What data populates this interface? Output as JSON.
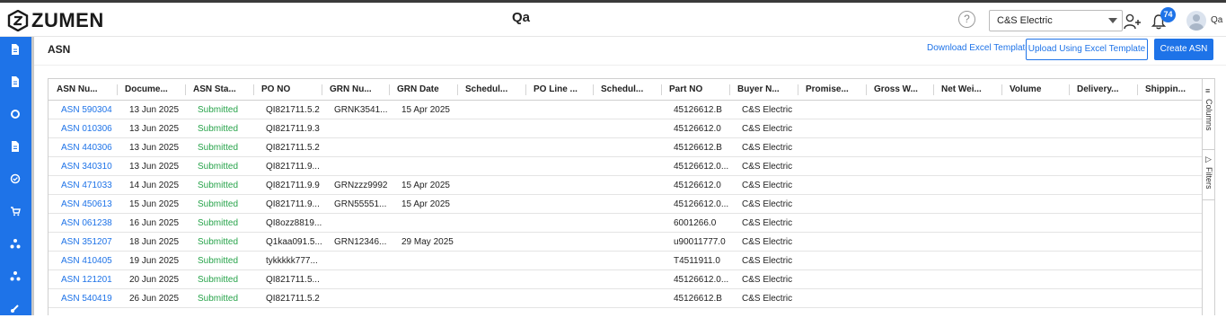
{
  "header": {
    "logo_text": "ZUMEN",
    "title": "Qa",
    "help_label": "?",
    "company": "C&S Electric",
    "notification_count": "74",
    "user_name": "Qa"
  },
  "sidebar": {
    "items": [
      {
        "icon": "document-icon"
      },
      {
        "icon": "document-icon"
      },
      {
        "icon": "settings-icon"
      },
      {
        "icon": "document-icon"
      },
      {
        "icon": "check-circle-icon"
      },
      {
        "icon": "cart-icon"
      },
      {
        "icon": "network-icon"
      },
      {
        "icon": "network-icon"
      },
      {
        "icon": "link-icon"
      }
    ]
  },
  "page": {
    "title": "ASN",
    "download_label": "Download Excel Template",
    "upload_label": "Upload Using Excel Template",
    "create_label": "Create ASN"
  },
  "grid": {
    "columns": [
      "ASN Nu...",
      "Docume...",
      "ASN Sta...",
      "PO NO",
      "GRN Nu...",
      "GRN Date",
      "Schedul...",
      "PO Line ...",
      "Schedul...",
      "Part NO",
      "Buyer N...",
      "Promise...",
      "Gross W...",
      "Net Wei...",
      "Volume",
      "Delivery...",
      "Shippin..."
    ],
    "rows": [
      [
        "ASN 590304",
        "13 Jun 2025",
        "Submitted",
        "QI821711.5.2",
        "GRNK3541...",
        "15 Apr 2025",
        "",
        "",
        "",
        "45126612.B",
        "C&S Electric",
        "",
        "",
        "",
        "",
        "",
        ""
      ],
      [
        "ASN 010306",
        "13 Jun 2025",
        "Submitted",
        "QI821711.9.3",
        "",
        "",
        "",
        "",
        "",
        "45126612.0",
        "C&S Electric",
        "",
        "",
        "",
        "",
        "",
        ""
      ],
      [
        "ASN 440306",
        "13 Jun 2025",
        "Submitted",
        "QI821711.5.2",
        "",
        "",
        "",
        "",
        "",
        "45126612.B",
        "C&S Electric",
        "",
        "",
        "",
        "",
        "",
        ""
      ],
      [
        "ASN 340310",
        "13 Jun 2025",
        "Submitted",
        "QI821711.9...",
        "",
        "",
        "",
        "",
        "",
        "45126612.0...",
        "C&S Electric",
        "",
        "",
        "",
        "",
        "",
        ""
      ],
      [
        "ASN 471033",
        "14 Jun 2025",
        "Submitted",
        "QI821711.9.9",
        "GRNzzz9992",
        "15 Apr 2025",
        "",
        "",
        "",
        "45126612.0",
        "C&S Electric",
        "",
        "",
        "",
        "",
        "",
        ""
      ],
      [
        "ASN 450613",
        "15 Jun 2025",
        "Submitted",
        "QI821711.9...",
        "GRN55551...",
        "15 Apr 2025",
        "",
        "",
        "",
        "45126612.0...",
        "C&S Electric",
        "",
        "",
        "",
        "",
        "",
        ""
      ],
      [
        "ASN 061238",
        "16 Jun 2025",
        "Submitted",
        "QI8ozz8819...",
        "",
        "",
        "",
        "",
        "",
        "6001266.0",
        "C&S Electric",
        "",
        "",
        "",
        "",
        "",
        ""
      ],
      [
        "ASN 351207",
        "18 Jun 2025",
        "Submitted",
        "Q1kaa091.5...",
        "GRN12346...",
        "29 May 2025",
        "",
        "",
        "",
        "u90011777.0",
        "C&S Electric",
        "",
        "",
        "",
        "",
        "",
        ""
      ],
      [
        "ASN 410405",
        "19 Jun 2025",
        "Submitted",
        "tykkkkk777...",
        "",
        "",
        "",
        "",
        "",
        "T4511911.0",
        "C&S Electric",
        "",
        "",
        "",
        "",
        "",
        ""
      ],
      [
        "ASN 121201",
        "20 Jun 2025",
        "Submitted",
        "QI821711.5...",
        "",
        "",
        "",
        "",
        "",
        "45126612.0...",
        "C&S Electric",
        "",
        "",
        "",
        "",
        "",
        ""
      ],
      [
        "ASN 540419",
        "26 Jun 2025",
        "Submitted",
        "QI821711.5.2",
        "",
        "",
        "",
        "",
        "",
        "45126612.B",
        "C&S Electric",
        "",
        "",
        "",
        "",
        "",
        ""
      ]
    ],
    "tool_columns": "Columns",
    "tool_filters": "Filters"
  },
  "colors": {
    "accent": "#1e73e8",
    "status_submitted": "#27a34a"
  }
}
